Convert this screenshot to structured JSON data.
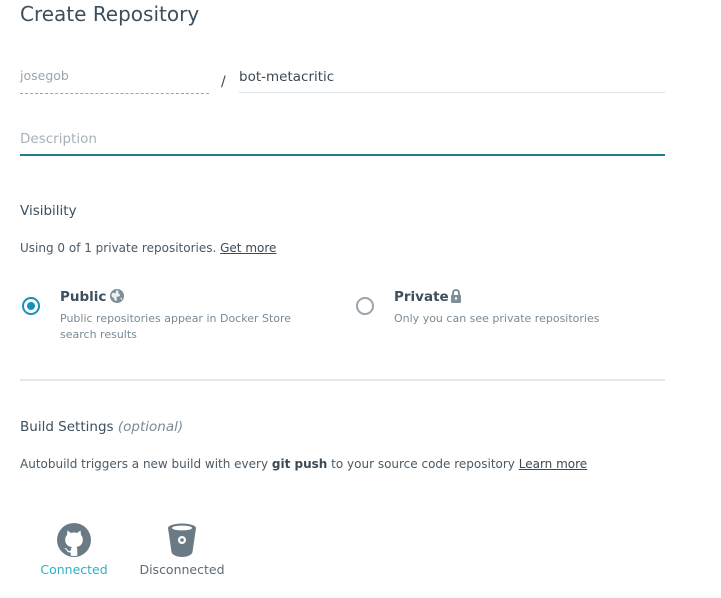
{
  "page": {
    "title": "Create Repository"
  },
  "form": {
    "namespace_value": "josegob",
    "separator": "/",
    "name_value": "bot-metacritic",
    "description_placeholder": "Description"
  },
  "visibility": {
    "label": "Visibility",
    "note_prefix": "Using 0 of 1 private repositories.",
    "note_link": "Get more",
    "options": [
      {
        "id": "public",
        "title": "Public",
        "icon": "globe-icon",
        "description": "Public repositories appear in Docker Store search results",
        "selected": true
      },
      {
        "id": "private",
        "title": "Private",
        "icon": "lock-icon",
        "description": "Only you can see private repositories",
        "selected": false
      }
    ]
  },
  "build": {
    "label": "Build Settings",
    "label_optional": "(optional)",
    "text_prefix": "Autobuild triggers a new build with every",
    "text_bold": "git push",
    "text_suffix": "to your source code repository",
    "learn_more": "Learn more",
    "providers": [
      {
        "name": "GitHub",
        "icon": "github-icon",
        "status": "Connected",
        "color": "#2ab2c7"
      },
      {
        "name": "Bitbucket",
        "icon": "bitbucket-icon",
        "status": "Disconnected",
        "color": "#5c6b76"
      }
    ]
  },
  "colors": {
    "accent": "#1a8fbd",
    "focus_underline": "#237a8a",
    "connected": "#2ab2c7",
    "icon_gray": "#7f8f9a"
  }
}
